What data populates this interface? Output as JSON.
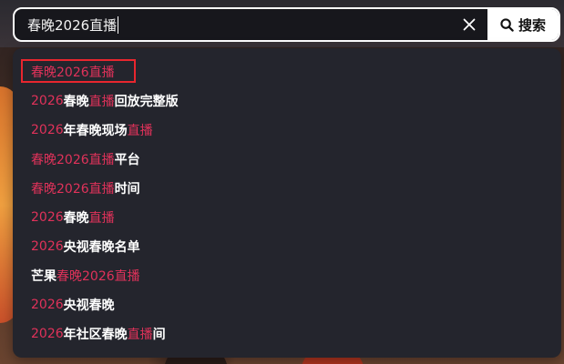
{
  "search": {
    "query": "春晚2026直播",
    "button_label": "搜索",
    "icons": {
      "clear": "close-icon",
      "search": "search-icon"
    }
  },
  "suggestions": [
    {
      "segments": [
        {
          "text": "春晚2026直播",
          "highlight": true
        }
      ],
      "selected": true
    },
    {
      "segments": [
        {
          "text": "2026",
          "highlight": true
        },
        {
          "text": "春晚",
          "highlight": false
        },
        {
          "text": "直播",
          "highlight": true
        },
        {
          "text": "回放完整版",
          "highlight": false
        }
      ]
    },
    {
      "segments": [
        {
          "text": "2026",
          "highlight": true
        },
        {
          "text": "年春晚现场",
          "highlight": false
        },
        {
          "text": "直播",
          "highlight": true
        }
      ]
    },
    {
      "segments": [
        {
          "text": "春晚2026直播",
          "highlight": true
        },
        {
          "text": "平台",
          "highlight": false
        }
      ]
    },
    {
      "segments": [
        {
          "text": "春晚2026直播",
          "highlight": true
        },
        {
          "text": "时间",
          "highlight": false
        }
      ]
    },
    {
      "segments": [
        {
          "text": "2026",
          "highlight": true
        },
        {
          "text": "春晚",
          "highlight": false
        },
        {
          "text": "直播",
          "highlight": true
        }
      ]
    },
    {
      "segments": [
        {
          "text": "2026",
          "highlight": true
        },
        {
          "text": "央视春晚名单",
          "highlight": false
        }
      ]
    },
    {
      "segments": [
        {
          "text": "芒果",
          "highlight": false
        },
        {
          "text": "春晚2026直播",
          "highlight": true
        }
      ]
    },
    {
      "segments": [
        {
          "text": "2026",
          "highlight": true
        },
        {
          "text": "央视春晚",
          "highlight": false
        }
      ]
    },
    {
      "segments": [
        {
          "text": "2026",
          "highlight": true
        },
        {
          "text": "年社区春晚",
          "highlight": false
        },
        {
          "text": "直播",
          "highlight": true
        },
        {
          "text": "间",
          "highlight": false
        }
      ]
    }
  ],
  "colors": {
    "highlight": "#e0325a",
    "selection_border": "#e8262e",
    "dropdown_bg": "#24252d"
  }
}
